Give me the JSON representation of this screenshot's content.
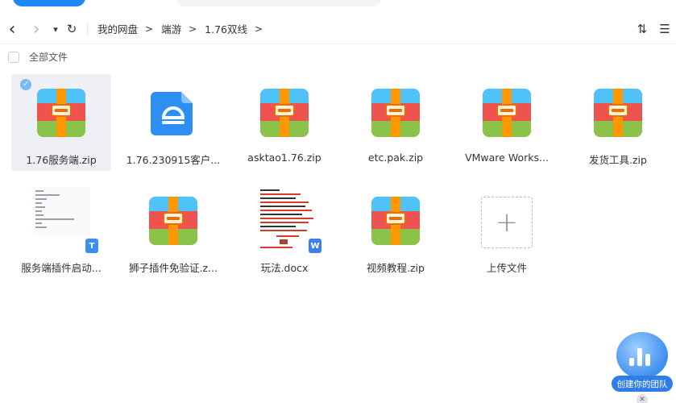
{
  "nav": {
    "back_icon": "chevron-left-icon",
    "forward_icon": "chevron-right-icon",
    "dropdown_icon": "caret-down-icon",
    "refresh_icon": "refresh-icon",
    "back_glyph": "‹",
    "forward_glyph": "›",
    "dropdown_glyph": "▾",
    "refresh_glyph": "↻"
  },
  "breadcrumb": {
    "items": [
      "我的网盘",
      "端游",
      "1.76双线"
    ],
    "separator": ">"
  },
  "tools": {
    "sort_glyph": "⇅",
    "view_glyph": "☰"
  },
  "select_all": {
    "label": "全部文件"
  },
  "files": [
    {
      "name": "1.76服务端.zip",
      "type": "zip",
      "selected": true
    },
    {
      "name": "1.76.230915客户...",
      "type": "app",
      "selected": false
    },
    {
      "name": "asktao1.76.zip",
      "type": "zip",
      "selected": false
    },
    {
      "name": "etc.pak.zip",
      "type": "zip",
      "selected": false
    },
    {
      "name": "VMware Works...",
      "type": "zip",
      "selected": false
    },
    {
      "name": "发货工具.zip",
      "type": "zip",
      "selected": false
    },
    {
      "name": "服务端插件启动...",
      "type": "txt-doc",
      "selected": false
    },
    {
      "name": "狮子插件免验证.z...",
      "type": "zip",
      "selected": false
    },
    {
      "name": "玩法.docx",
      "type": "word-doc",
      "selected": false
    },
    {
      "name": "视频教程.zip",
      "type": "zip",
      "selected": false
    }
  ],
  "upload": {
    "label": "上传文件",
    "glyph": "+"
  },
  "widget": {
    "label": "创建你的团队",
    "close_glyph": "✕"
  },
  "colors": {
    "accent": "#1e88f5",
    "zip_top": "#4fc3f7",
    "zip_mid": "#ef5350",
    "zip_bottom": "#8bc34a",
    "zip_strap": "#ff9800",
    "app_blue": "#2e8ff2",
    "txt_badge": "#3d8fef",
    "word_badge": "#3d7ff0"
  }
}
